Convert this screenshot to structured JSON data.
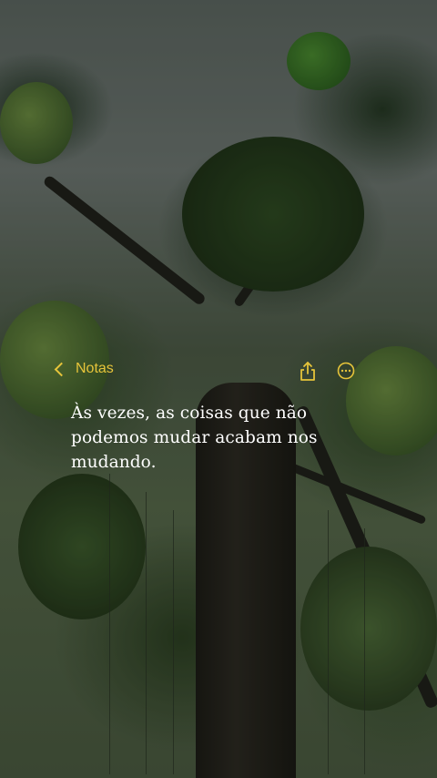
{
  "header": {
    "back_label": "Notas",
    "back_icon": "chevron-left-icon",
    "share_icon": "share-icon",
    "more_icon": "more-options-icon",
    "accent_color": "#e6c43a"
  },
  "note": {
    "text": "Às vezes, as coisas que não podemos mudar acabam nos mudando."
  }
}
